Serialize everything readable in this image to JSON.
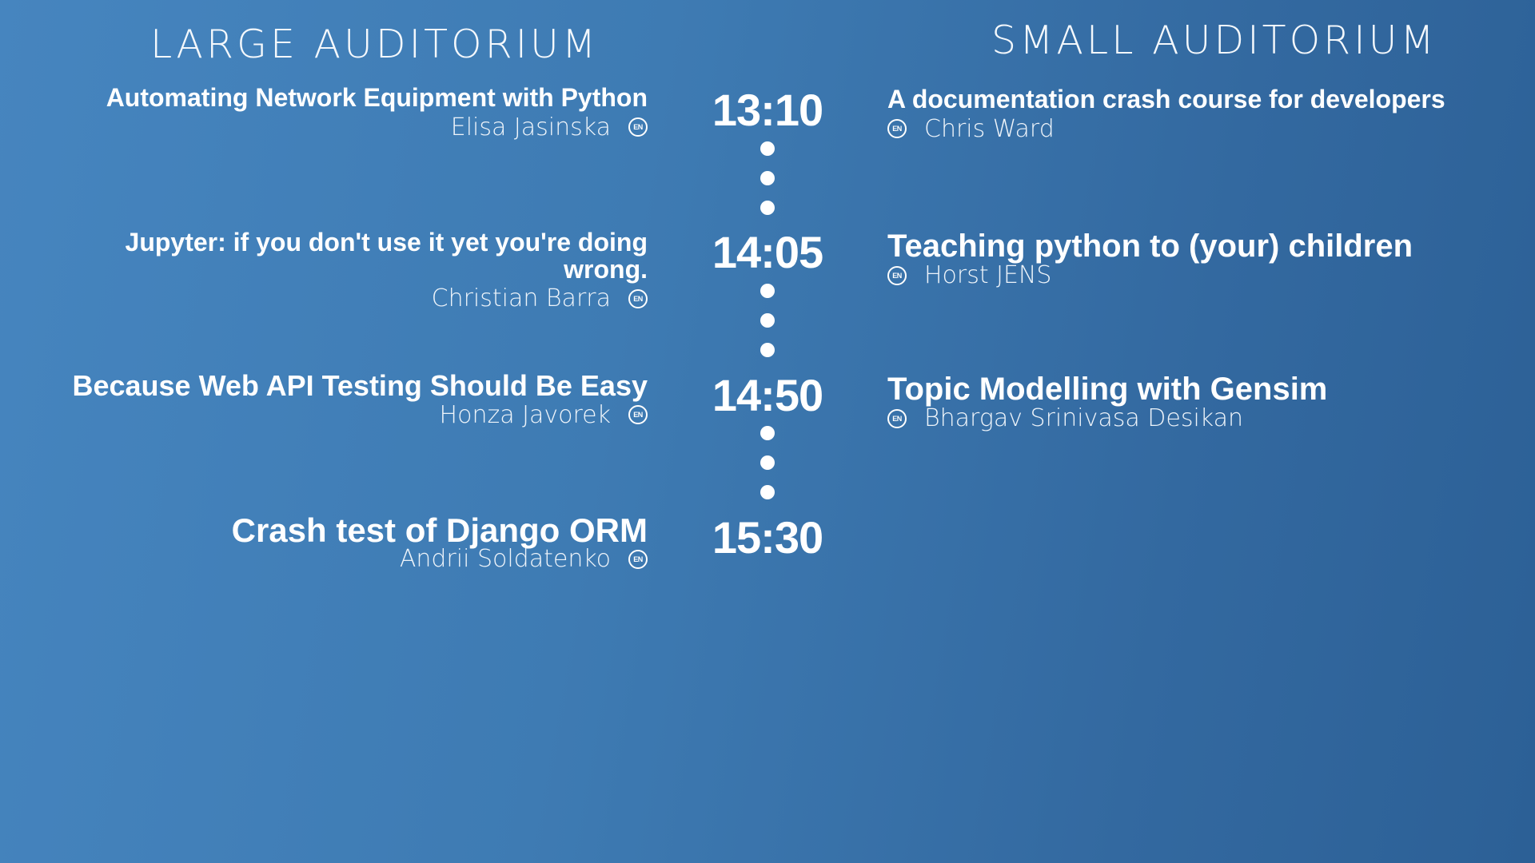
{
  "rooms": {
    "left": "LARGE AUDITORIUM",
    "right": "SMALL AUDITORIUM"
  },
  "times": [
    "13:10",
    "14:05",
    "14:50",
    "15:30"
  ],
  "large": [
    {
      "title": "Automating Network Equipment with Python",
      "speaker": "Elisa Jasinska",
      "lang": "EN"
    },
    {
      "title_line1": "Jupyter: if you don't use it yet you're doing",
      "title_line2": "wrong.",
      "speaker": "Christian Barra",
      "lang": "EN"
    },
    {
      "title": "Because Web API Testing Should Be Easy",
      "speaker": "Honza Javorek",
      "lang": "EN"
    },
    {
      "title": "Crash test of Django ORM",
      "speaker": "Andrii Soldatenko",
      "lang": "EN"
    }
  ],
  "small": [
    {
      "title": "A documentation crash course for developers",
      "speaker": "Chris Ward",
      "lang": "EN"
    },
    {
      "title": "Teaching python to (your) children",
      "speaker": "Horst JENS",
      "lang": "EN"
    },
    {
      "title": "Topic Modelling with Gensim",
      "speaker": "Bhargav Srinivasa Desikan",
      "lang": "EN"
    }
  ]
}
